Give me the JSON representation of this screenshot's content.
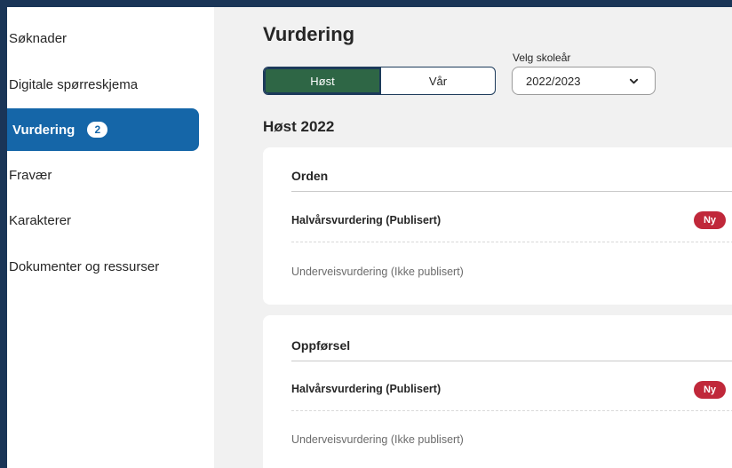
{
  "sidebar": {
    "items": [
      {
        "label": "Søknader"
      },
      {
        "label": "Digitale spørreskjema"
      },
      {
        "label": "Vurdering",
        "badge": "2"
      },
      {
        "label": "Fravær"
      },
      {
        "label": "Karakterer"
      },
      {
        "label": "Dokumenter og ressurser"
      }
    ],
    "active_index": 2
  },
  "main": {
    "title": "Vurdering",
    "semester_toggle": {
      "options": [
        "Høst",
        "Vår"
      ],
      "selected": "Høst"
    },
    "school_year": {
      "label": "Velg skoleår",
      "value": "2022/2023"
    },
    "season_heading": "Høst 2022",
    "cards": [
      {
        "title": "Orden",
        "rows": [
          {
            "label": "Halvårsvurdering (Publisert)",
            "badge": "Ny"
          },
          {
            "label": "Underveisvurdering (Ikke publisert)"
          }
        ]
      },
      {
        "title": "Oppførsel",
        "rows": [
          {
            "label": "Halvårsvurdering (Publisert)",
            "badge": "Ny"
          },
          {
            "label": "Underveisvurdering (Ikke publisert)"
          }
        ]
      }
    ]
  },
  "colors": {
    "frame": "#1a3557",
    "active_nav": "#1566a8",
    "selected_toggle": "#2e6645",
    "new_badge": "#c0283a",
    "content_bg": "#f1f1f1"
  },
  "icons": {
    "year_select": "chevron-down-icon"
  }
}
